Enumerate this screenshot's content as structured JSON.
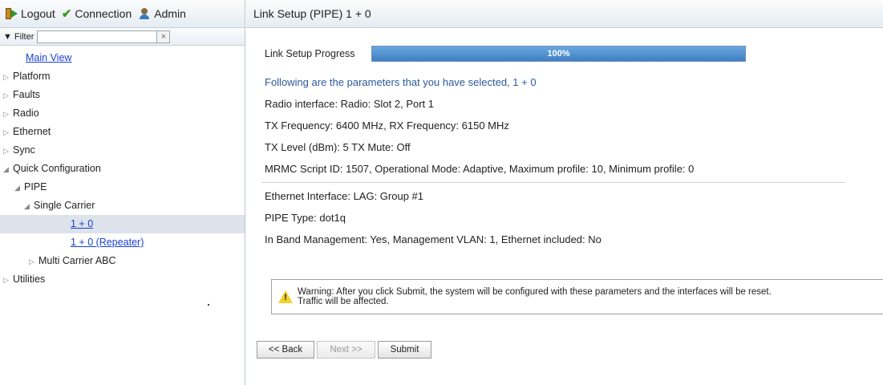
{
  "topbar": {
    "logout_label": "Logout",
    "connection_label": "Connection",
    "admin_label": "Admin"
  },
  "filter": {
    "label": "Filter",
    "value": "",
    "clear_symbol": "×"
  },
  "tree": {
    "main_view": "Main View",
    "platform": "Platform",
    "faults": "Faults",
    "radio": "Radio",
    "ethernet": "Ethernet",
    "sync": "Sync",
    "quick_configuration": "Quick Configuration",
    "pipe": "PIPE",
    "single_carrier": "Single Carrier",
    "one_plus_zero": "1 + 0",
    "one_plus_zero_repeater": "1 + 0 (Repeater)",
    "multi_carrier_abc": "Multi Carrier ABC",
    "utilities": "Utilities",
    "selected": "1 + 0"
  },
  "header": {
    "title": "Link Setup (PIPE) 1 + 0"
  },
  "progress": {
    "label": "Link Setup Progress",
    "percent_text": "100%",
    "value": 1.0
  },
  "summary": {
    "intro": "Following are the parameters that you have selected, 1 + 0",
    "radio_interface": "Radio interface: Radio: Slot 2, Port 1",
    "frequency": "TX Frequency: 6400 MHz, RX Frequency: 6150 MHz",
    "tx_level": "TX Level (dBm): 5 TX Mute: Off",
    "mrmc": "MRMC Script ID: 1507, Operational Mode: Adaptive, Maximum profile: 10, Minimum profile: 0",
    "ethernet_interface": "Ethernet Interface: LAG: Group #1",
    "pipe_type": "PIPE Type: dot1q",
    "in_band": "In Band Management: Yes, Management VLAN: 1, Ethernet included: No"
  },
  "warning": {
    "line1": "Warning: After you click Submit, the system will be configured with these parameters and the interfaces will be reset.",
    "line2": "Traffic will be affected."
  },
  "buttons": {
    "back": "<< Back",
    "next": "Next >>",
    "submit": "Submit",
    "next_disabled": true
  },
  "colors": {
    "link": "#1a3fd6",
    "intro_text": "#2a5a9a",
    "progress_fill": "#4f8fd0",
    "warning_icon": "#f2cf2a",
    "selected_row": "#dde3ea"
  }
}
